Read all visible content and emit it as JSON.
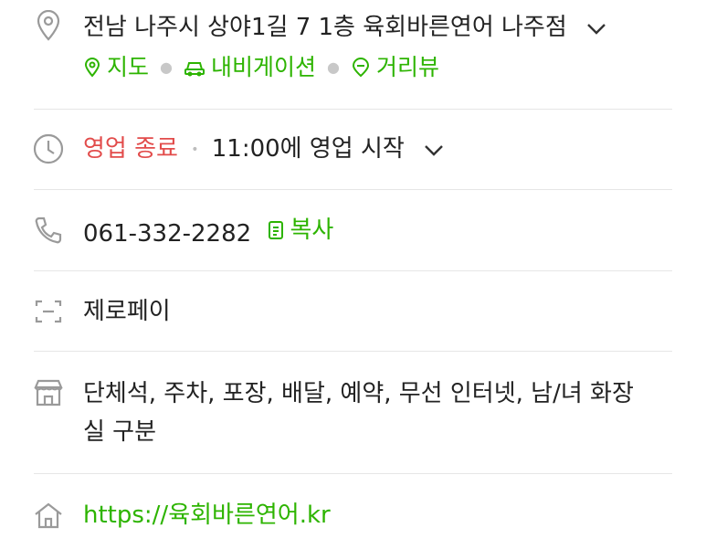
{
  "address": {
    "text": "전남 나주시 상야1길 7 1층 육회바른연어 나주점",
    "links": [
      {
        "label": "지도",
        "icon": "map-pin-icon"
      },
      {
        "label": "내비게이션",
        "icon": "car-icon"
      },
      {
        "label": "거리뷰",
        "icon": "street-view-icon"
      }
    ]
  },
  "hours": {
    "status": "영업 종료",
    "next": "11:00에 영업 시작"
  },
  "phone": {
    "number": "061-332-2282",
    "copy_label": "복사"
  },
  "payment": {
    "text": "제로페이"
  },
  "amenities": {
    "line1": "단체석, 주차, 포장, 배달, 예약, 무선 인터넷, 남/녀 화장",
    "line2": "실 구분"
  },
  "website": {
    "url": "https://육회바른연어.kr"
  },
  "colors": {
    "accent_green": "#2db400",
    "status_red": "#e24c4b",
    "icon_gray": "#9a9a9a",
    "divider": "#e6e6e6"
  }
}
